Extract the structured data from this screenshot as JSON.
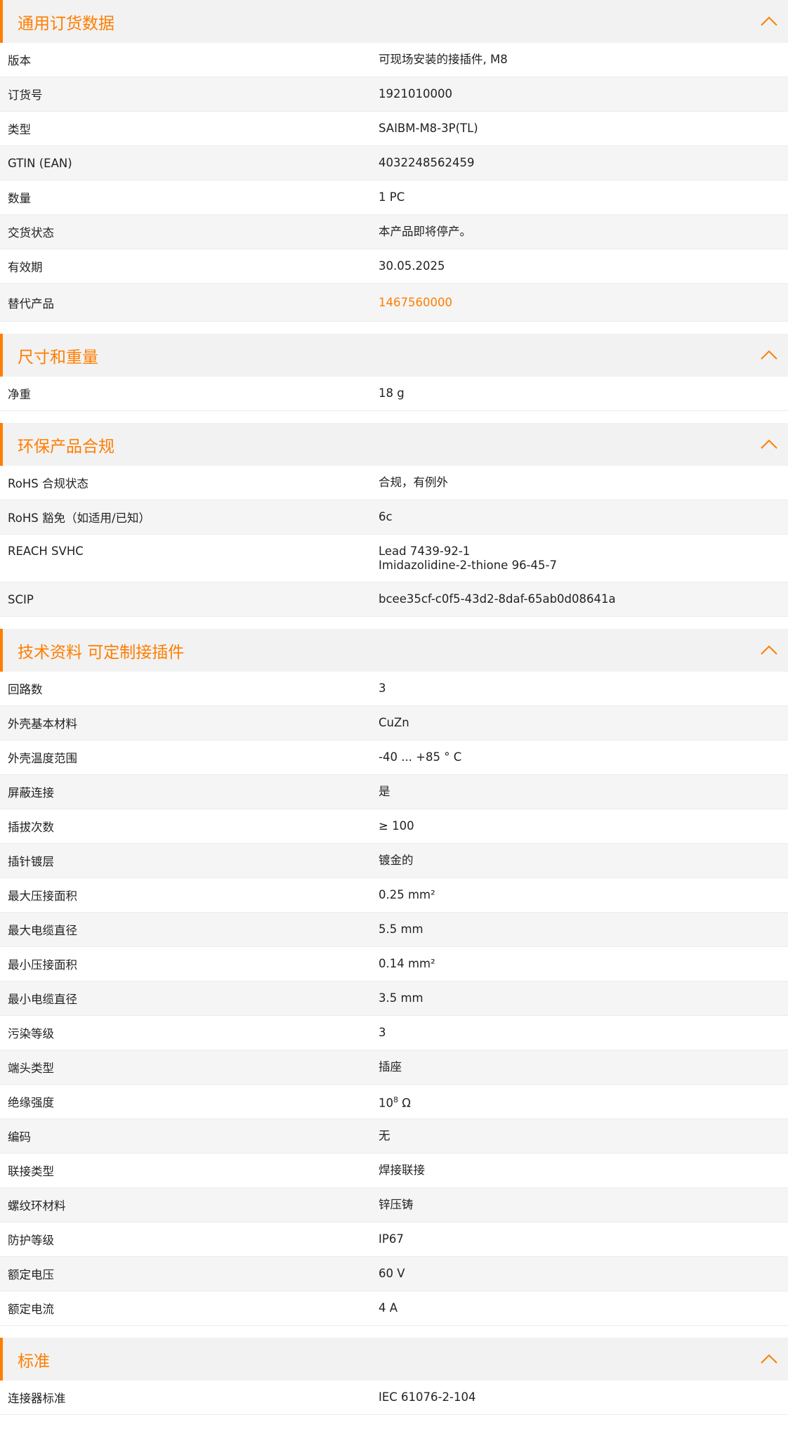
{
  "colors": {
    "accent": "#ff7d00",
    "header_bg": "#f2f2f2",
    "row_alt_bg": "#f5f5f5"
  },
  "icons": {
    "collapse": "chevron-up-icon"
  },
  "sections": {
    "general": {
      "title": "通用订货数据",
      "rows": [
        {
          "label": "版本",
          "value": "可现场安装的接插件, M8"
        },
        {
          "label": "订货号",
          "value": "1921010000"
        },
        {
          "label": "类型",
          "value": "SAIBM-M8-3P(TL)"
        },
        {
          "label": "GTIN (EAN)",
          "value": "4032248562459"
        },
        {
          "label": "数量",
          "value": "1  PC"
        },
        {
          "label": "交货状态",
          "value": "本产品即将停产。"
        },
        {
          "label": "有效期",
          "value": "30.05.2025"
        },
        {
          "label": "替代产品",
          "value": "1467560000"
        }
      ]
    },
    "dimensions": {
      "title": "尺寸和重量",
      "rows": [
        {
          "label": "净重",
          "value": "18  g"
        }
      ]
    },
    "environment": {
      "title": "环保产品合规",
      "rows": [
        {
          "label": "RoHS 合规状态",
          "value": "合规，有例外"
        },
        {
          "label": "RoHS 豁免（如适用/已知）",
          "value": "6c"
        },
        {
          "label": "REACH SVHC",
          "value_lines": [
            "Lead 7439-92-1",
            "Imidazolidine-2-thione 96-45-7"
          ]
        },
        {
          "label": "SCIP",
          "value": "bcee35cf-c0f5-43d2-8daf-65ab0d08641a"
        }
      ]
    },
    "technical": {
      "title": "技术资料 可定制接插件",
      "rows": [
        {
          "label": "回路数",
          "value": "3"
        },
        {
          "label": "外壳基本材料",
          "value": "CuZn"
        },
        {
          "label": "外壳温度范围",
          "value": "-40 ... +85 ° C"
        },
        {
          "label": "屏蔽连接",
          "value": "是"
        },
        {
          "label": "插拔次数",
          "value": "≥ 100"
        },
        {
          "label": "插针镀层",
          "value": "镀金的"
        },
        {
          "label": "最大压接面积",
          "value": "0.25  mm²"
        },
        {
          "label": "最大电缆直径",
          "value": "5.5  mm"
        },
        {
          "label": "最小压接面积",
          "value": "0.14  mm²"
        },
        {
          "label": "最小电缆直径",
          "value": "3.5  mm"
        },
        {
          "label": "污染等级",
          "value": "3"
        },
        {
          "label": "端头类型",
          "value": "插座"
        },
        {
          "label": "绝缘强度",
          "value_base": "10",
          "value_sup": "8",
          "value_unit": " Ω"
        },
        {
          "label": "编码",
          "value": "无"
        },
        {
          "label": "联接类型",
          "value": "焊接联接"
        },
        {
          "label": "螺纹环材料",
          "value": "锌压铸"
        },
        {
          "label": "防护等级",
          "value": "IP67"
        },
        {
          "label": "额定电压",
          "value": "60  V"
        },
        {
          "label": "额定电流",
          "value": "4  A"
        }
      ]
    },
    "standards": {
      "title": "标准",
      "rows": [
        {
          "label": "连接器标准",
          "value": "IEC 61076-2-104"
        }
      ]
    }
  }
}
